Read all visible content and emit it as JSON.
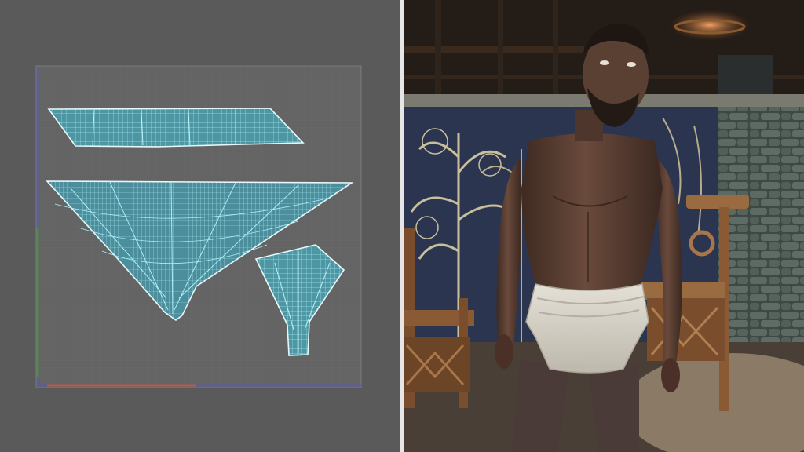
{
  "left_panel": {
    "view": "uv-editor",
    "colors": {
      "background": "#5a5a5a",
      "grid_area": "#636363",
      "grid_line": "#6b6b6b",
      "uv_wire": "#7ed6e6",
      "uv_fill": "#5aa7b5",
      "axis_u": "#b85a4a",
      "axis_v": "#4a8a4a",
      "axis_side": "#5a5aa0"
    },
    "islands": [
      "uv-island-top-strip",
      "uv-island-triangle",
      "uv-island-fan"
    ]
  },
  "right_panel": {
    "view": "3d-character-preview",
    "colors": {
      "skin": "#5a3f33",
      "cloth": "#dad6cc",
      "tapestry": "#2c3650",
      "stone": "#4e5a55",
      "wood": "#8a5a34"
    }
  }
}
